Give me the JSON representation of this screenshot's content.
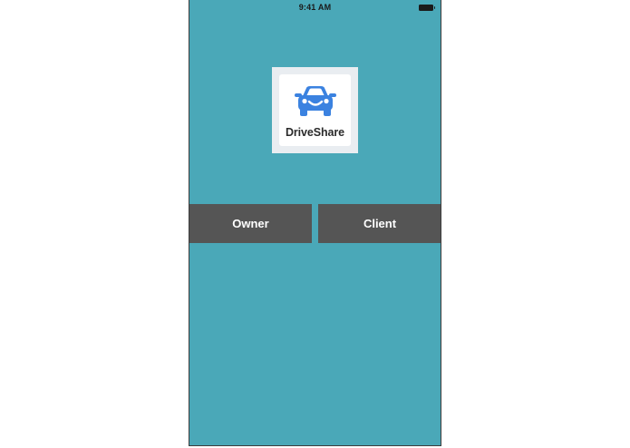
{
  "status_bar": {
    "time": "9:41 AM",
    "battery_icon": "battery-full-icon"
  },
  "logo": {
    "icon": "car-smile-icon",
    "brand_name": "DriveShare",
    "brand_color": "#3b82e0"
  },
  "roles": {
    "owner_label": "Owner",
    "client_label": "Client"
  },
  "colors": {
    "background": "#4aa8b8",
    "button": "#555555",
    "button_text": "#ffffff"
  }
}
